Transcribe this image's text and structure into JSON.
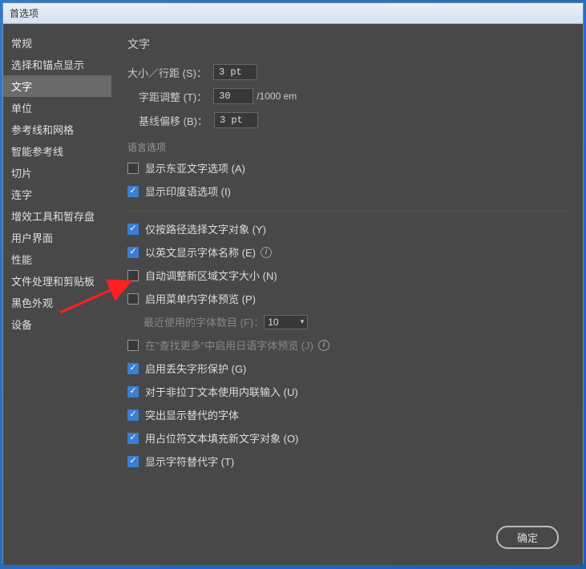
{
  "window": {
    "title": "首选项"
  },
  "sidebar": {
    "items": [
      {
        "label": "常规"
      },
      {
        "label": "选择和锚点显示"
      },
      {
        "label": "文字"
      },
      {
        "label": "单位"
      },
      {
        "label": "参考线和网格"
      },
      {
        "label": "智能参考线"
      },
      {
        "label": "切片"
      },
      {
        "label": "连字"
      },
      {
        "label": "增效工具和暂存盘"
      },
      {
        "label": "用户界面"
      },
      {
        "label": "性能"
      },
      {
        "label": "文件处理和剪贴板"
      },
      {
        "label": "黑色外观"
      },
      {
        "label": "设备"
      }
    ]
  },
  "main": {
    "title": "文字",
    "size_label": "大小／行距 (S)：",
    "size_value": "3 pt",
    "tracking_label": "字距调整 (T)：",
    "tracking_value": "30",
    "tracking_unit": "/1000 em",
    "baseline_label": "基线偏移 (B)：",
    "baseline_value": "3 pt",
    "lang_section": "语言选项",
    "cb_east_asian": "显示东亚文字选项 (A)",
    "cb_indic": "显示印度语选项 (I)",
    "cb_path_select": "仅按路径选择文字对象 (Y)",
    "cb_english_fonts": "以英文显示字体名称 (E)",
    "cb_auto_size": "自动调整新区域文字大小 (N)",
    "cb_menu_preview": "启用菜单内字体预览 (P)",
    "recent_fonts_label": "最近使用的字体数目 (F)：",
    "recent_fonts_value": "10",
    "cb_jp_preview": "在\"查找更多\"中启用日语字体预览 (J)",
    "cb_glyph_protect": "启用丢失字形保护 (G)",
    "cb_inline_input": "对于非拉丁文本使用内联输入 (U)",
    "cb_highlight_alt": "突出显示替代的字体",
    "cb_placeholder_fill": "用占位符文本填充新文字对象 (O)",
    "cb_show_alt_glyphs": "显示字符替代字 (T)",
    "ok_button": "确定"
  }
}
